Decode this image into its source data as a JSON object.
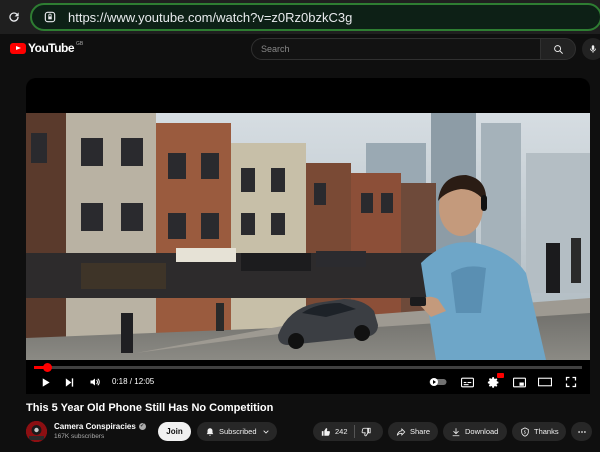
{
  "browser": {
    "url": "https://www.youtube.com/watch?v=z0Rz0bzkC3g"
  },
  "header": {
    "logo_text": "YouTube",
    "country_code": "GB",
    "search_placeholder": "Search"
  },
  "player": {
    "progress": 0.0247,
    "time_display": "0:18 / 12:05"
  },
  "video": {
    "title": "This 5 Year Old Phone Still Has No Competition"
  },
  "channel": {
    "name": "Camera Conspiracies",
    "subscribers": "167K subscribers",
    "join_label": "Join",
    "subscribed_label": "Subscribed"
  },
  "actions": {
    "like_count": "242",
    "share_label": "Share",
    "download_label": "Download",
    "thanks_label": "Thanks"
  },
  "colors": {
    "accent": "#ff0000",
    "url_border": "#2e7d32",
    "background": "#0f0f0f"
  }
}
